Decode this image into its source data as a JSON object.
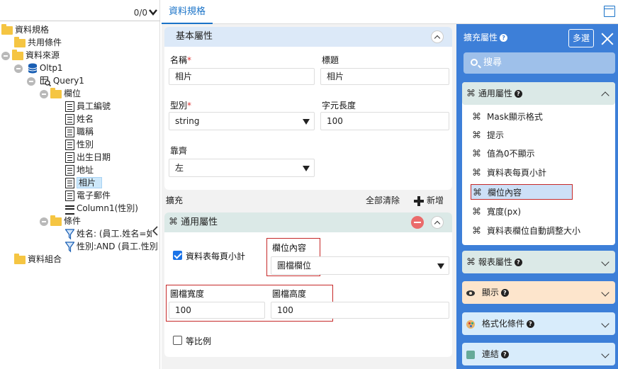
{
  "tree": {
    "count": "0/0",
    "nodes": [
      {
        "label": "資料規格"
      },
      {
        "label": "共用條件"
      },
      {
        "label": "資料來源"
      },
      {
        "label": "Oltp1"
      },
      {
        "label": "Query1"
      },
      {
        "label": "欄位"
      },
      {
        "label": "員工編號"
      },
      {
        "label": "姓名"
      },
      {
        "label": "職稱"
      },
      {
        "label": "性別"
      },
      {
        "label": "出生日期"
      },
      {
        "label": "地址"
      },
      {
        "label": "相片"
      },
      {
        "label": "電子郵件"
      },
      {
        "label": "Column1(性別)"
      },
      {
        "label": "條件"
      },
      {
        "label": "姓名: (員工.姓名=如"
      },
      {
        "label": "性別:AND (員工.性別"
      },
      {
        "label": "資料組合"
      }
    ]
  },
  "tabs": {
    "active": "資料規格"
  },
  "basic": {
    "header": "基本屬性",
    "name_label": "名稱",
    "name_value": "相片",
    "title_label": "標題",
    "title_value": "相片",
    "type_label": "型別",
    "type_value": "string",
    "length_label": "字元長度",
    "length_value": "100",
    "align_label": "靠齊",
    "align_value": "左"
  },
  "extension": {
    "label": "擴充",
    "clear_all": "全部清除",
    "add": "新增"
  },
  "common_card": {
    "header": "通用屬性",
    "subtotal_label": "資料表每頁小計",
    "column_content_label": "欄位內容",
    "column_content_value": "圖檔欄位",
    "img_width_label": "圖檔寬度",
    "img_width_value": "100",
    "img_height_label": "圖檔高度",
    "img_height_value": "100",
    "ratio_label": "等比例"
  },
  "right": {
    "title": "擴充屬性",
    "multi_select": "多選",
    "search_placeholder": "搜尋",
    "common_section": "通用屬性",
    "common_items": [
      {
        "label": "Mask顯示格式"
      },
      {
        "label": "提示"
      },
      {
        "label": "值為0不顯示"
      },
      {
        "label": "資料表每頁小計"
      },
      {
        "label": "欄位內容"
      },
      {
        "label": "寬度(px)"
      },
      {
        "label": "資料表欄位自動調整大小"
      }
    ],
    "report_section": "報表屬性",
    "display_section": "顯示",
    "format_section": "格式化條件",
    "link_section": "連結"
  },
  "colors": {
    "accent": "#1a73c8",
    "right_panel_bg": "#3d7fd8",
    "highlight_box": "#c62828",
    "remove_btn": "#ea6b6b"
  }
}
